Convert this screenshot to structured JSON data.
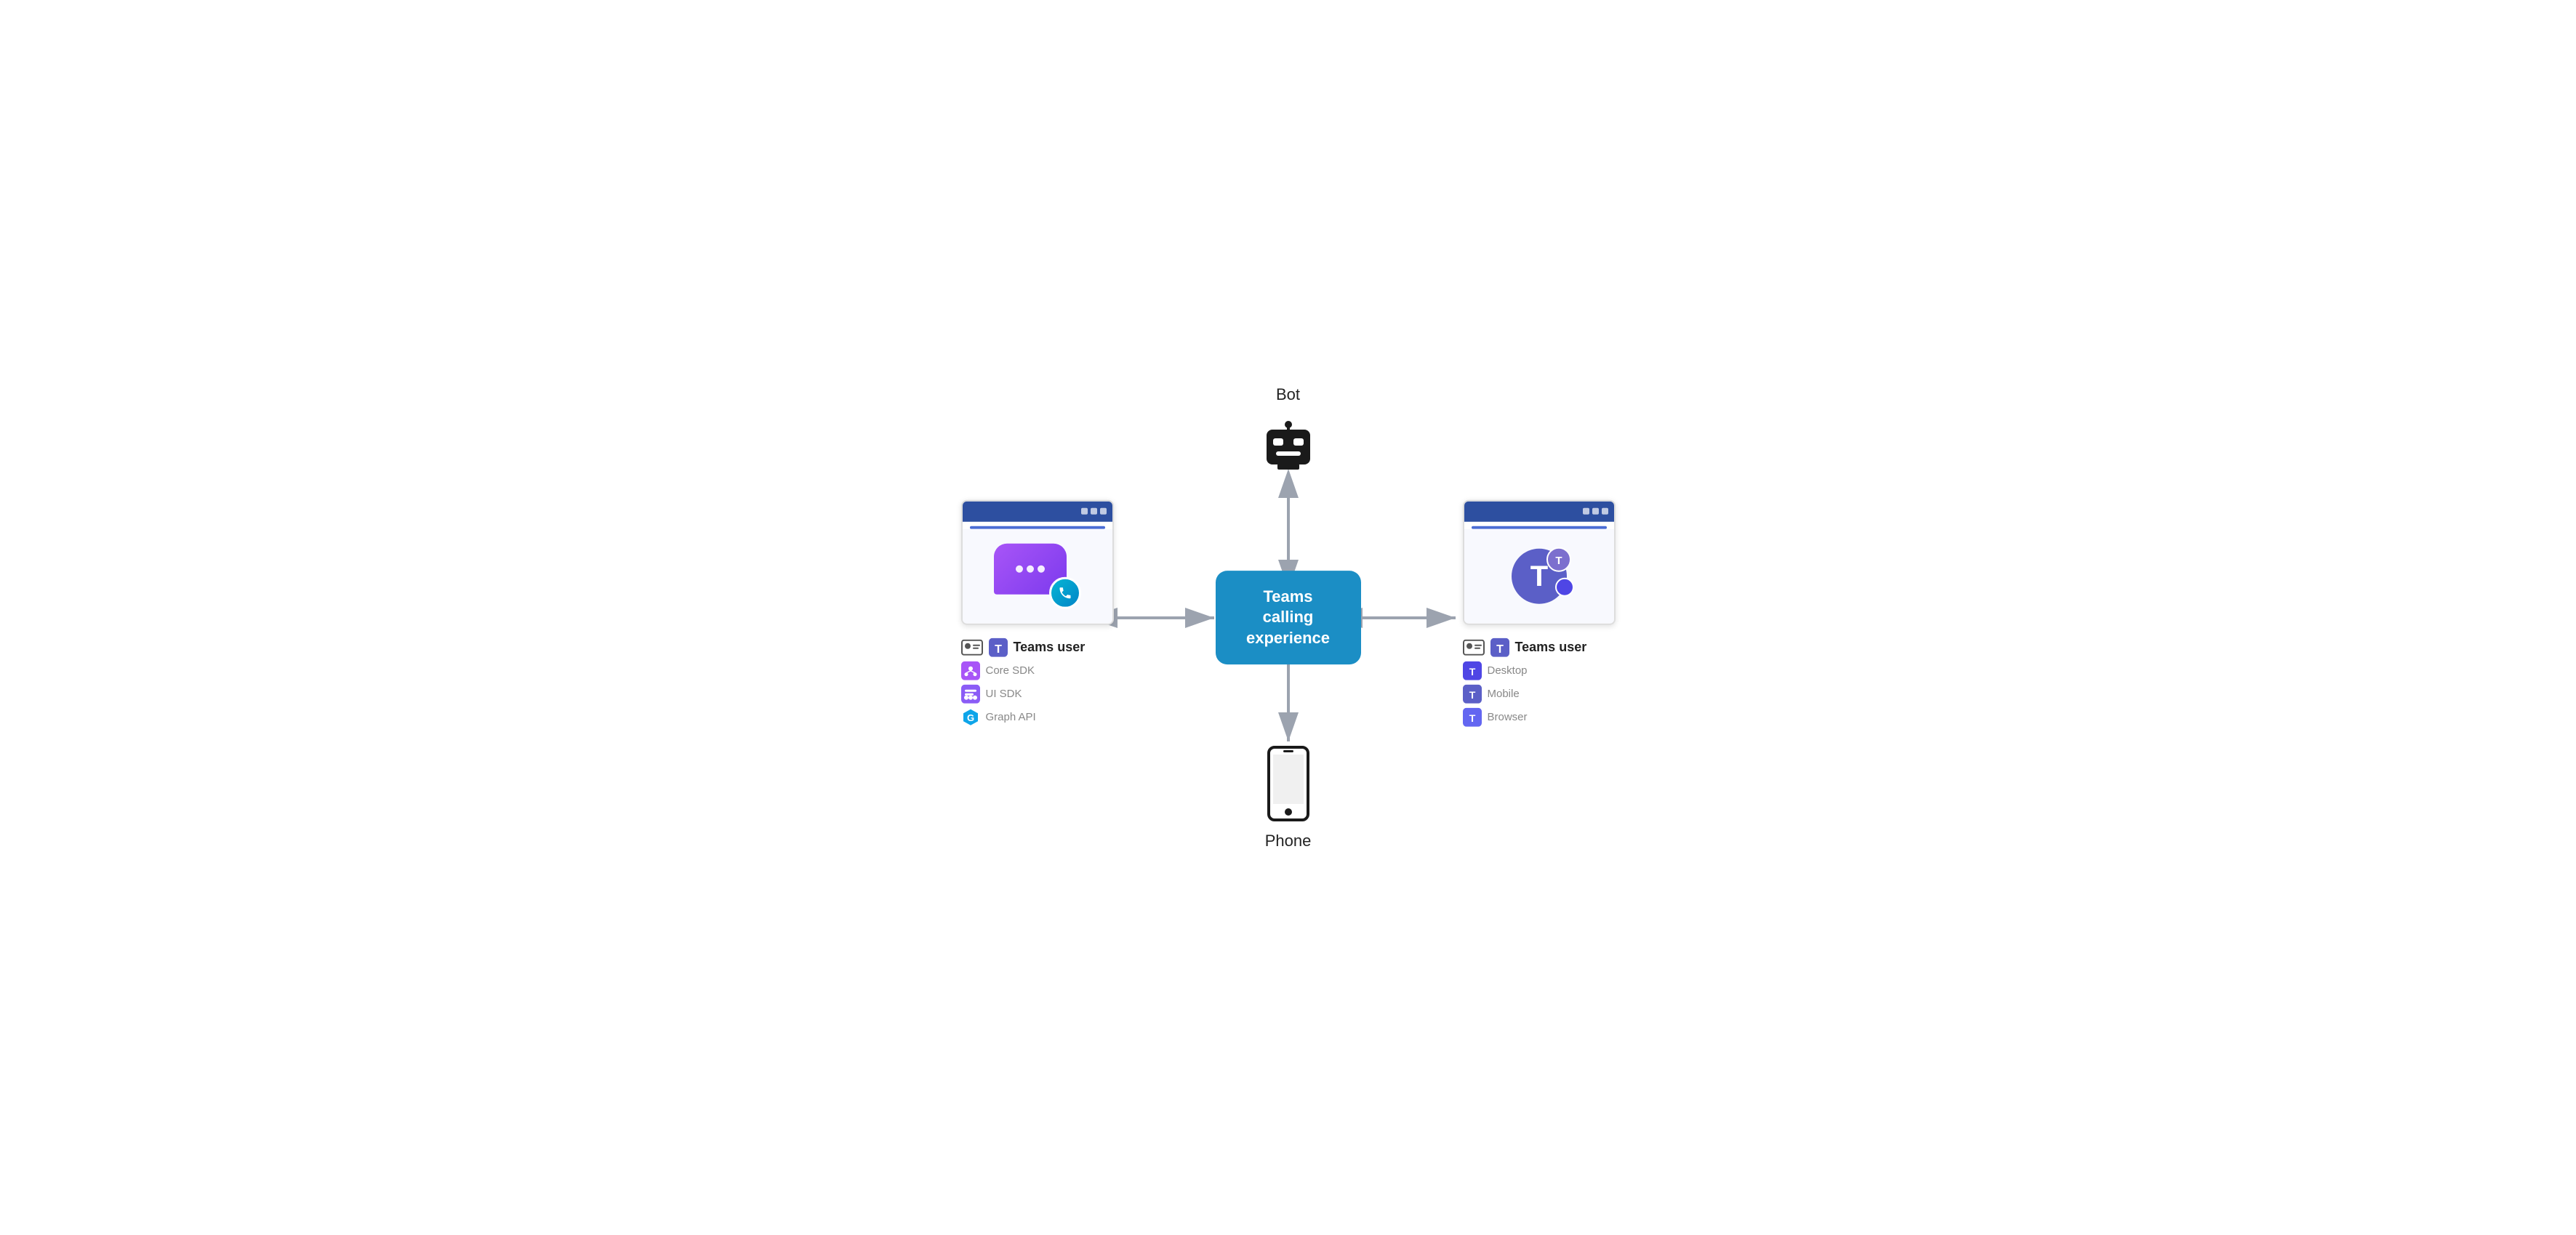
{
  "center": {
    "label": "Teams calling experience"
  },
  "bot": {
    "label": "Bot"
  },
  "phone": {
    "label": "Phone"
  },
  "left_panel": {
    "title": "Teams user",
    "items": [
      {
        "icon": "core-sdk-icon",
        "label": "Core SDK"
      },
      {
        "icon": "ui-sdk-icon",
        "label": "UI SDK"
      },
      {
        "icon": "graph-api-icon",
        "label": "Graph API"
      }
    ]
  },
  "right_panel": {
    "title": "Teams user",
    "items": [
      {
        "icon": "desktop-icon",
        "label": "Desktop"
      },
      {
        "icon": "mobile-icon",
        "label": "Mobile"
      },
      {
        "icon": "browser-icon",
        "label": "Browser"
      }
    ]
  }
}
